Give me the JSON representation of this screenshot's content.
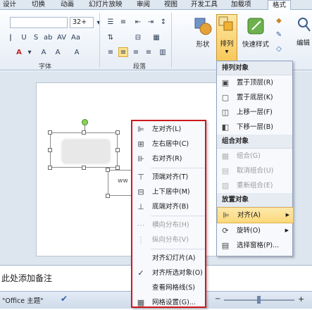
{
  "tabs": [
    "设计",
    "切换",
    "动画",
    "幻灯片放映",
    "审阅",
    "视图",
    "开发工具",
    "加载项",
    "格式"
  ],
  "ribbon": {
    "font_size": "32+",
    "font_group_label": "字体",
    "paragraph_group_label": "段落",
    "shape_label": "形状",
    "arrange_label": "排列",
    "quick_style_label": "快速样式",
    "edit_label": "编辑"
  },
  "slide": {
    "text_fragment": "ww"
  },
  "notes_placeholder": "此处添加备注",
  "status": {
    "theme": "\"Office 主题\""
  },
  "arrange_menu": {
    "sections": [
      {
        "header": "排列对象",
        "items": [
          {
            "label": "置于顶层(R)",
            "icon": "bring-to-front-icon",
            "disabled": false
          },
          {
            "label": "置于底层(K)",
            "icon": "send-to-back-icon",
            "disabled": false
          },
          {
            "label": "上移一层(F)",
            "icon": "bring-forward-icon",
            "disabled": false
          },
          {
            "label": "下移一层(B)",
            "icon": "send-backward-icon",
            "disabled": false
          }
        ]
      },
      {
        "header": "组合对象",
        "items": [
          {
            "label": "组合(G)",
            "icon": "group-icon",
            "disabled": true
          },
          {
            "label": "取消组合(U)",
            "icon": "ungroup-icon",
            "disabled": true
          },
          {
            "label": "重新组合(E)",
            "icon": "regroup-icon",
            "disabled": true
          }
        ]
      },
      {
        "header": "放置对象",
        "items": [
          {
            "label": "对齐(A)",
            "icon": "align-icon",
            "disabled": false,
            "highlighted": true,
            "submenu": true
          },
          {
            "label": "旋转(O)",
            "icon": "rotate-icon",
            "disabled": false,
            "submenu": true
          },
          {
            "label": "选择窗格(P)...",
            "icon": "selection-pane-icon",
            "disabled": false
          }
        ]
      }
    ]
  },
  "align_menu": {
    "items": [
      {
        "label": "左对齐(L)",
        "icon": "align-left-icon",
        "disabled": false
      },
      {
        "label": "左右居中(C)",
        "icon": "align-center-icon",
        "disabled": false
      },
      {
        "label": "右对齐(R)",
        "icon": "align-right-icon",
        "disabled": false
      },
      {
        "sep": true
      },
      {
        "label": "顶端对齐(T)",
        "icon": "align-top-icon",
        "disabled": false
      },
      {
        "label": "上下居中(M)",
        "icon": "align-middle-icon",
        "disabled": false
      },
      {
        "label": "底端对齐(B)",
        "icon": "align-bottom-icon",
        "disabled": false
      },
      {
        "sep": true
      },
      {
        "label": "横向分布(H)",
        "icon": "distribute-horizontal-icon",
        "disabled": true
      },
      {
        "label": "纵向分布(V)",
        "icon": "distribute-vertical-icon",
        "disabled": true
      },
      {
        "sep": true
      },
      {
        "label": "对齐幻灯片(A)",
        "icon": "",
        "disabled": false
      },
      {
        "label": "对齐所选对象(O)",
        "icon": "checkmark-icon",
        "disabled": false,
        "checked": true
      },
      {
        "label": "查看网格线(S)",
        "icon": "",
        "disabled": false
      },
      {
        "label": "网格设置(G)...",
        "icon": "grid-settings-icon",
        "disabled": false
      }
    ]
  }
}
